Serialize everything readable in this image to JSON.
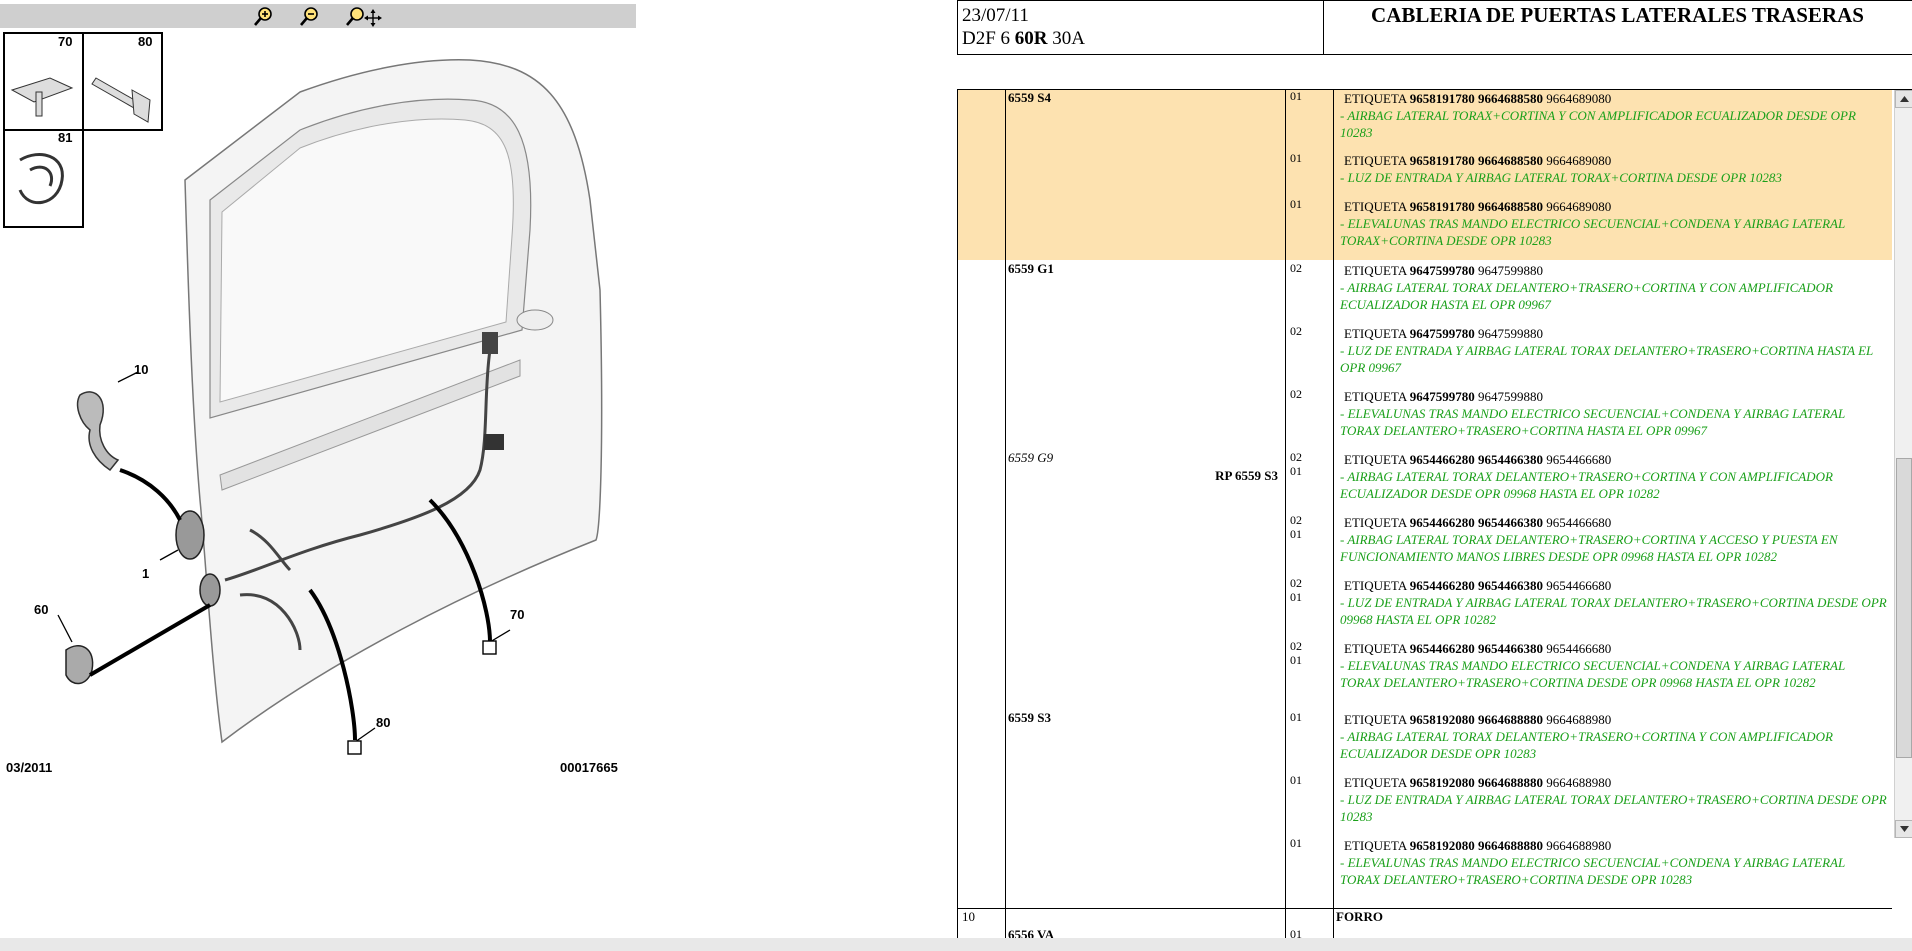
{
  "toolbar": {
    "icons": [
      "zoom-in-icon",
      "zoom-out-icon",
      "pan-zoom-icon"
    ]
  },
  "drawing": {
    "callouts": [
      "70",
      "80",
      "81",
      "10",
      "1",
      "60",
      "70",
      "80"
    ],
    "date": "03/2011",
    "ref": "00017665"
  },
  "header": {
    "date": "23/07/11",
    "code_prefix": "D2F 6",
    "code_bold": "60R",
    "code_suffix": "30A",
    "title": "CABLERIA DE PUERTAS LATERALES TRASERAS"
  },
  "groups": [
    {
      "code": "6559 S4",
      "entries": [
        {
          "qty": "01",
          "label": "ETIQUETA",
          "b1": "9658191780",
          "b2": "9664688580",
          "ref": "9664689080",
          "cond": "- AIRBAG LATERAL TORAX+CORTINA Y CON AMPLIFICADOR ECUALIZADOR DESDE OPR 10283"
        },
        {
          "qty": "01",
          "label": "ETIQUETA",
          "b1": "9658191780",
          "b2": "9664688580",
          "ref": "9664689080",
          "cond": "- LUZ DE ENTRADA Y AIRBAG LATERAL TORAX+CORTINA DESDE OPR 10283"
        },
        {
          "qty": "01",
          "label": "ETIQUETA",
          "b1": "9658191780",
          "b2": "9664688580",
          "ref": "9664689080",
          "cond": "- ELEVALUNAS TRAS MANDO ELECTRICO SECUENCIAL+CONDENA Y AIRBAG LATERAL TORAX+CORTINA DESDE OPR 10283"
        }
      ]
    },
    {
      "code": "6559 G1",
      "entries": [
        {
          "qty": "02",
          "label": "ETIQUETA",
          "b1": "9647599780",
          "b2": "",
          "ref": "9647599880",
          "cond": "- AIRBAG LATERAL TORAX DELANTERO+TRASERO+CORTINA Y CON AMPLIFICADOR ECUALIZADOR HASTA EL OPR 09967"
        },
        {
          "qty": "02",
          "label": "ETIQUETA",
          "b1": "9647599780",
          "b2": "",
          "ref": "9647599880",
          "cond": "- LUZ DE ENTRADA Y AIRBAG LATERAL TORAX DELANTERO+TRASERO+CORTINA HASTA EL OPR 09967"
        },
        {
          "qty": "02",
          "label": "ETIQUETA",
          "b1": "9647599780",
          "b2": "",
          "ref": "9647599880",
          "cond": "- ELEVALUNAS TRAS MANDO ELECTRICO SECUENCIAL+CONDENA Y AIRBAG LATERAL TORAX DELANTERO+TRASERO+CORTINA HASTA EL OPR 09967"
        }
      ]
    },
    {
      "code": "6559 G9",
      "rp": "RP 6559 S3",
      "entries": [
        {
          "qty": "02",
          "qty2": "01",
          "label": "ETIQUETA",
          "b1": "9654466280",
          "b2": "9654466380",
          "ref": "9654466680",
          "cond": "- AIRBAG LATERAL TORAX DELANTERO+TRASERO+CORTINA Y CON AMPLIFICADOR ECUALIZADOR DESDE OPR 09968 HASTA EL OPR 10282"
        },
        {
          "qty": "02",
          "qty2": "01",
          "label": "ETIQUETA",
          "b1": "9654466280",
          "b2": "9654466380",
          "ref": "9654466680",
          "cond": "- AIRBAG LATERAL TORAX DELANTERO+TRASERO+CORTINA Y ACCESO Y PUESTA EN FUNCIONAMIENTO MANOS LIBRES DESDE OPR 09968 HASTA EL OPR 10282"
        },
        {
          "qty": "02",
          "qty2": "01",
          "label": "ETIQUETA",
          "b1": "9654466280",
          "b2": "9654466380",
          "ref": "9654466680",
          "cond": "- LUZ DE ENTRADA Y AIRBAG LATERAL TORAX DELANTERO+TRASERO+CORTINA DESDE OPR 09968 HASTA EL OPR 10282"
        },
        {
          "qty": "02",
          "qty2": "01",
          "label": "ETIQUETA",
          "b1": "9654466280",
          "b2": "9654466380",
          "ref": "9654466680",
          "cond": "- ELEVALUNAS TRAS MANDO ELECTRICO SECUENCIAL+CONDENA Y AIRBAG LATERAL TORAX DELANTERO+TRASERO+CORTINA DESDE OPR 09968 HASTA EL OPR 10282"
        }
      ]
    },
    {
      "code": "6559 S3",
      "entries": [
        {
          "qty": "01",
          "label": "ETIQUETA",
          "b1": "9658192080",
          "b2": "9664688880",
          "ref": "9664688980",
          "cond": "- AIRBAG LATERAL TORAX DELANTERO+TRASERO+CORTINA Y CON AMPLIFICADOR ECUALIZADOR DESDE OPR 10283"
        },
        {
          "qty": "01",
          "label": "ETIQUETA",
          "b1": "9658192080",
          "b2": "9664688880",
          "ref": "9664688980",
          "cond": "- LUZ DE ENTRADA Y AIRBAG LATERAL TORAX DELANTERO+TRASERO+CORTINA DESDE OPR 10283"
        },
        {
          "qty": "01",
          "label": "ETIQUETA",
          "b1": "9658192080",
          "b2": "9664688880",
          "ref": "9664688980",
          "cond": "- ELEVALUNAS TRAS MANDO ELECTRICO SECUENCIAL+CONDENA Y AIRBAG LATERAL TORAX DELANTERO+TRASERO+CORTINA DESDE OPR 10283"
        }
      ]
    }
  ],
  "next_row": {
    "num": "10",
    "code": "6556 VA",
    "qty": "01",
    "label": "FORRO"
  }
}
